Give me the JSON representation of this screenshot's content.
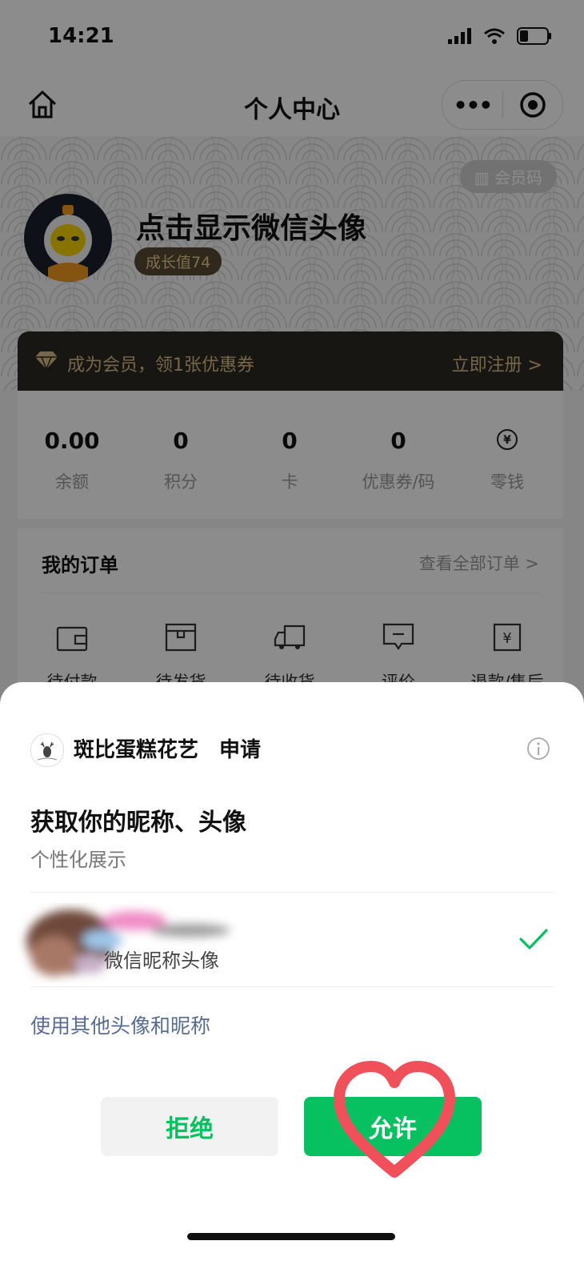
{
  "status_bar": {
    "time": "14:21"
  },
  "nav": {
    "title": "个人中心",
    "more_label": "•••"
  },
  "profile": {
    "member_code_label": "会员码",
    "name": "点击显示微信头像",
    "growth": "成长值74"
  },
  "vip_banner": {
    "text": "成为会员，领1张优惠券",
    "register_label": "立即注册 >"
  },
  "stats": [
    {
      "value": "0.00",
      "label": "余额"
    },
    {
      "value": "0",
      "label": "积分"
    },
    {
      "value": "0",
      "label": "卡"
    },
    {
      "value": "0",
      "label": "优惠券/码"
    },
    {
      "value": "",
      "label": "零钱"
    }
  ],
  "orders": {
    "title": "我的订单",
    "view_all": "查看全部订单 >",
    "items": [
      {
        "label": "待付款",
        "icon": "wallet-icon"
      },
      {
        "label": "待发货",
        "icon": "box-icon"
      },
      {
        "label": "待收货",
        "icon": "truck-icon"
      },
      {
        "label": "评价",
        "icon": "comment-icon"
      },
      {
        "label": "退款/售后",
        "icon": "refund-icon"
      }
    ]
  },
  "sheet": {
    "app_name": "斑比蛋糕花艺",
    "request_label": "申请",
    "permission_title": "获取你的昵称、头像",
    "permission_desc": "个性化展示",
    "profile_option_label": "微信昵称头像",
    "other_option_label": "使用其他头像和昵称",
    "reject_label": "拒绝",
    "allow_label": "允许"
  },
  "colors": {
    "wechat_green": "#07c160",
    "link_blue": "#576b95",
    "vip_gold": "#d9bc85",
    "heart_red": "#f0505a"
  }
}
